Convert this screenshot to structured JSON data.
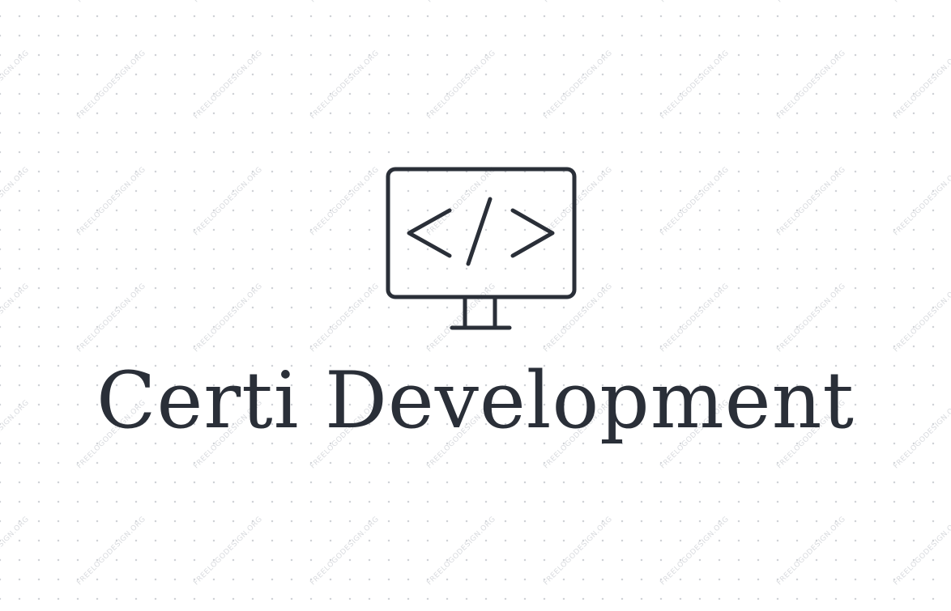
{
  "brand": {
    "name": "Certi Development",
    "text_color": "#2a2f38"
  },
  "logo": {
    "icon": "monitor-code-icon",
    "stroke_color": "#2a2f38"
  },
  "watermark": {
    "text": "FREELOGODESIGN.ORG",
    "color": "#d9dbdf"
  },
  "background": {
    "color": "#ffffff",
    "dot_color": "#cfd2d6"
  }
}
